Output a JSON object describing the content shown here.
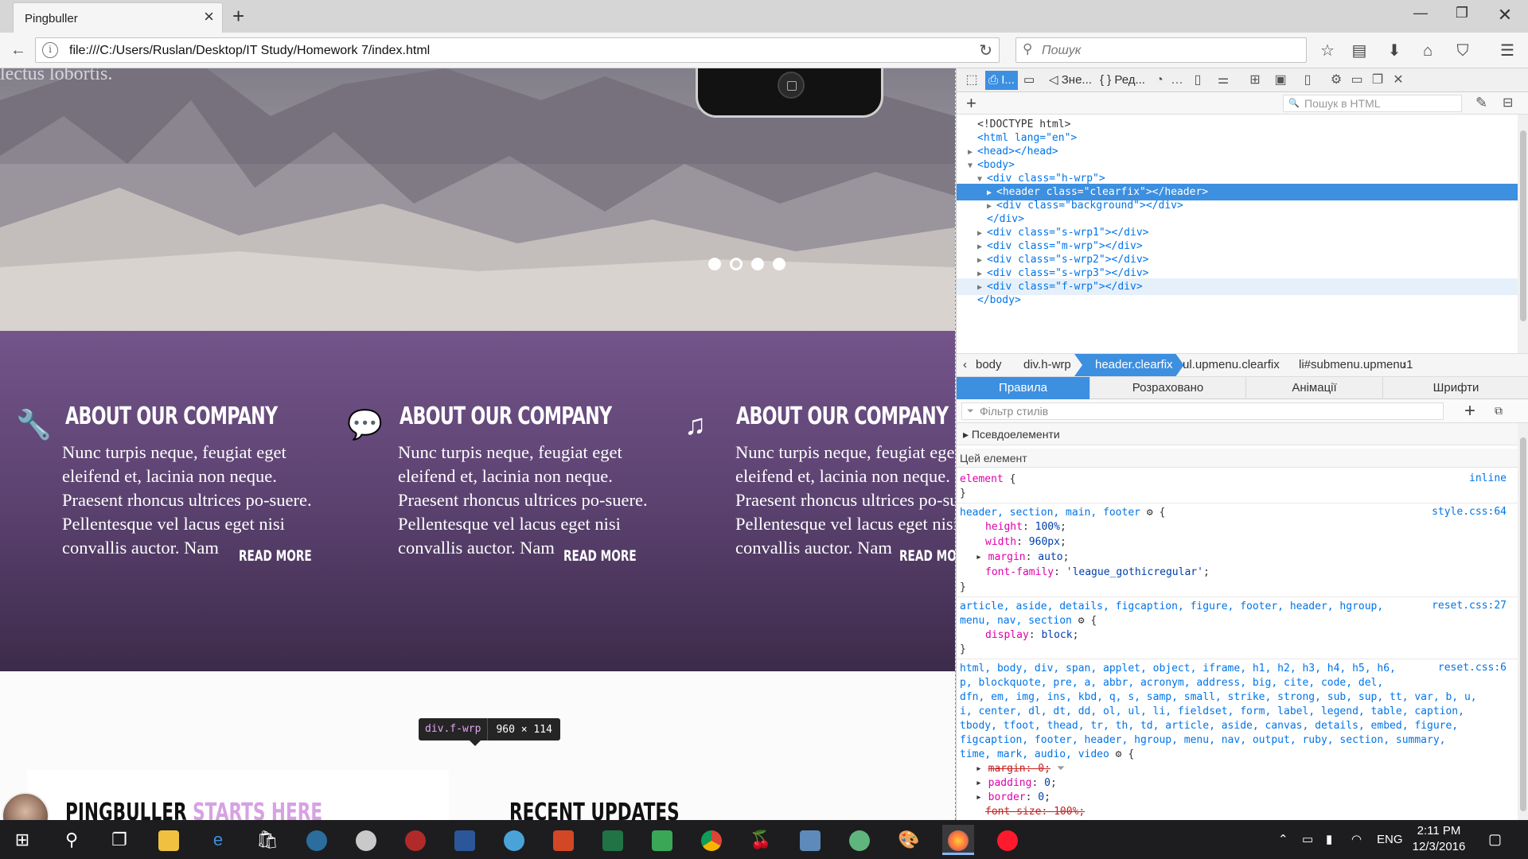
{
  "browser": {
    "tab_title": "Pingbuller",
    "url": "file:///C:/Users/Ruslan/Desktop/IT Study/Homework 7/index.html",
    "search_placeholder": "Пошук"
  },
  "page": {
    "ghost_text": "lectus lobortis.",
    "slider_dot_count": 4,
    "slider_active_index": 1,
    "features": [
      {
        "icon": "wrench-icon",
        "glyph": "🔧",
        "title": "ABOUT OUR COMPANY",
        "body": "Nunc turpis neque, feugiat eget eleifend et, lacinia non neque. Praesent rhoncus ultrices po-suere. Pellentesque vel lacus eget nisi convallis auctor. Nam",
        "more": "READ MORE"
      },
      {
        "icon": "speech-bubble-icon",
        "glyph": "💬",
        "title": "ABOUT OUR COMPANY",
        "body": "Nunc turpis neque, feugiat eget eleifend et, lacinia non neque. Praesent rhoncus ultrices po-suere. Pellentesque vel lacus eget nisi convallis auctor. Nam",
        "more": "READ MORE"
      },
      {
        "icon": "music-note-icon",
        "glyph": "♫",
        "title": "ABOUT OUR COMPANY",
        "body": "Nunc turpis neque, feugiat eget eleifend et, lacinia non neque. Praesent rhoncus ultrices po-suere. Pellentesque vel lacus eget nisi convallis auctor. Nam",
        "more": "READ MORE"
      }
    ],
    "brand_main": "PINGBULLER",
    "brand_highlight": "STARTS HERE",
    "recent_title": "RECENT UPDATES",
    "colors": {
      "brand_highlight": "#d6a2e3",
      "feature_band_top": "#74548a",
      "feature_band_bottom": "#3d2b4a"
    }
  },
  "inspector_tooltip": {
    "selector": "div.f-wrp",
    "dimensions": "960 × 114"
  },
  "devtools": {
    "toolbar": {
      "inspector_tab": "І...",
      "console_tab": "Зне...",
      "editor_tab": "Ред..."
    },
    "html_search_placeholder": "Пошук в HTML",
    "markup": [
      {
        "text": "<!DOCTYPE html>"
      },
      {
        "text": "<html lang=\"en\">"
      },
      {
        "text": "<head></head>"
      },
      {
        "text": "<body>"
      },
      {
        "text": "<div class=\"h-wrp\">"
      },
      {
        "text": "<header class=\"clearfix\"></header>"
      },
      {
        "text": "<div class=\"background\"></div>"
      },
      {
        "text": "</div>"
      },
      {
        "text": "<div class=\"s-wrp1\"></div>"
      },
      {
        "text": "<div class=\"m-wrp\"></div>"
      },
      {
        "text": "<div class=\"s-wrp2\"></div>"
      },
      {
        "text": "<div class=\"s-wrp3\"></div>"
      },
      {
        "text": "<div class=\"f-wrp\"></div>"
      },
      {
        "text": "</body>"
      }
    ],
    "breadcrumbs": [
      "body",
      "div.h-wrp",
      "header.clearfix",
      "ul.upmenu.clearfix",
      "li#submenu.upmenu1"
    ],
    "breadcrumb_active_index": 2,
    "rule_tabs": [
      "Правила",
      "Розраховано",
      "Анімації",
      "Шрифти"
    ],
    "rule_tab_active_index": 0,
    "filter_placeholder": "Фільтр стилів",
    "pseudo_label": "Псевдоелементи",
    "this_element_label": "Цей елемент",
    "rules": {
      "element_selector": "element",
      "element_source": "inline",
      "r1_selector": "header, section, main, footer",
      "r1_source": "style.css:64",
      "r1_props": [
        {
          "name": "height",
          "value": "100%"
        },
        {
          "name": "width",
          "value": "960px"
        },
        {
          "name": "margin",
          "value": "auto"
        },
        {
          "name": "font-family",
          "value": "'league_gothicregular'"
        }
      ],
      "r2_selector_line1": "article, aside, details, figcaption, figure, footer, header, hgroup,",
      "r2_selector_line2": "menu, nav, section",
      "r2_source": "reset.css:27",
      "r2_props": [
        {
          "name": "display",
          "value": "block"
        }
      ],
      "r3_source": "reset.css:6",
      "r3_selector_lines": [
        "html, body, div, span, applet, object, iframe, h1, h2, h3, h4, h5, h6,",
        "p, blockquote, pre, a, abbr, acronym, address, big, cite, code, del,",
        "dfn, em, img, ins, kbd, q, s, samp, small, strike, strong, sub, sup, tt, var, b, u,",
        "i, center, dl, dt, dd, ol, ul, li, fieldset, form, label, legend, table, caption,",
        "tbody, tfoot, thead, tr, th, td, article, aside, canvas, details, embed, figure,",
        "figcaption, footer, header, hgroup, menu, nav, output, ruby, section, summary,",
        "time, mark, audio, video"
      ],
      "r3_props": [
        {
          "name": "margin",
          "value": "0",
          "overridden": true
        },
        {
          "name": "padding",
          "value": "0"
        },
        {
          "name": "border",
          "value": "0"
        },
        {
          "name": "font-size",
          "value": "100%"
        }
      ]
    }
  },
  "taskbar": {
    "language": "ENG",
    "time": "2:11 PM",
    "date": "12/3/2016"
  }
}
